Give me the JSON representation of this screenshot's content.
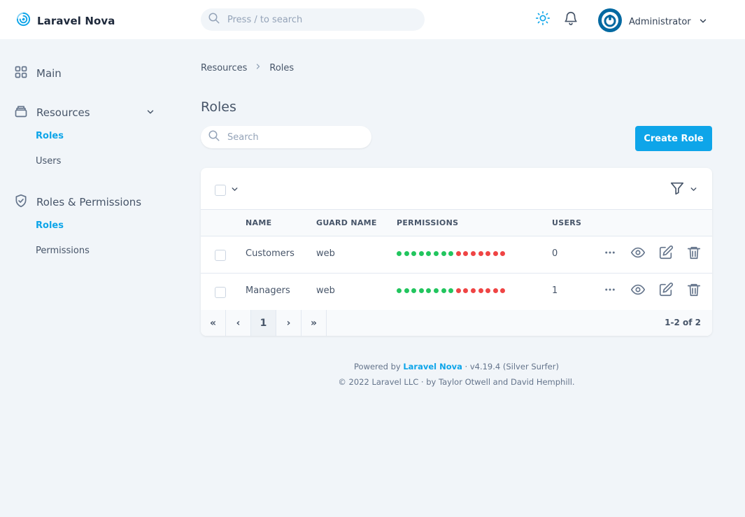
{
  "brand": {
    "name": "Laravel Nova",
    "accent": "#0ea5e9"
  },
  "header": {
    "search_placeholder": "Press / to search",
    "user_name": "Administrator"
  },
  "sidebar": {
    "main_label": "Main",
    "resources_label": "Resources",
    "resources_items": [
      {
        "label": "Roles",
        "active": true
      },
      {
        "label": "Users",
        "active": false
      }
    ],
    "roles_permissions_label": "Roles & Permissions",
    "roles_permissions_items": [
      {
        "label": "Roles",
        "active": true
      },
      {
        "label": "Permissions",
        "active": false
      }
    ]
  },
  "breadcrumb": {
    "parent": "Resources",
    "current": "Roles"
  },
  "page": {
    "title": "Roles",
    "search_placeholder": "Search",
    "create_label": "Create Role"
  },
  "table": {
    "columns": [
      "NAME",
      "GUARD NAME",
      "PERMISSIONS",
      "USERS"
    ],
    "rows": [
      {
        "name": "Customers",
        "guard": "web",
        "users": "0",
        "permissions_granted": 8,
        "permissions_total": 15
      },
      {
        "name": "Managers",
        "guard": "web",
        "users": "1",
        "permissions_granted": 8,
        "permissions_total": 15
      }
    ],
    "permission_colors": {
      "granted": "#22c55e",
      "denied": "#ef4444"
    }
  },
  "pagination": {
    "first": "«",
    "prev": "‹",
    "current": "1",
    "next": "›",
    "last": "»",
    "count_text": "1-2 of 2"
  },
  "footer": {
    "powered_prefix": "Powered by",
    "powered_link": "Laravel Nova",
    "version": "· v4.19.4 (Silver Surfer)",
    "copyright": "© 2022 Laravel LLC · by Taylor Otwell and David Hemphill."
  }
}
